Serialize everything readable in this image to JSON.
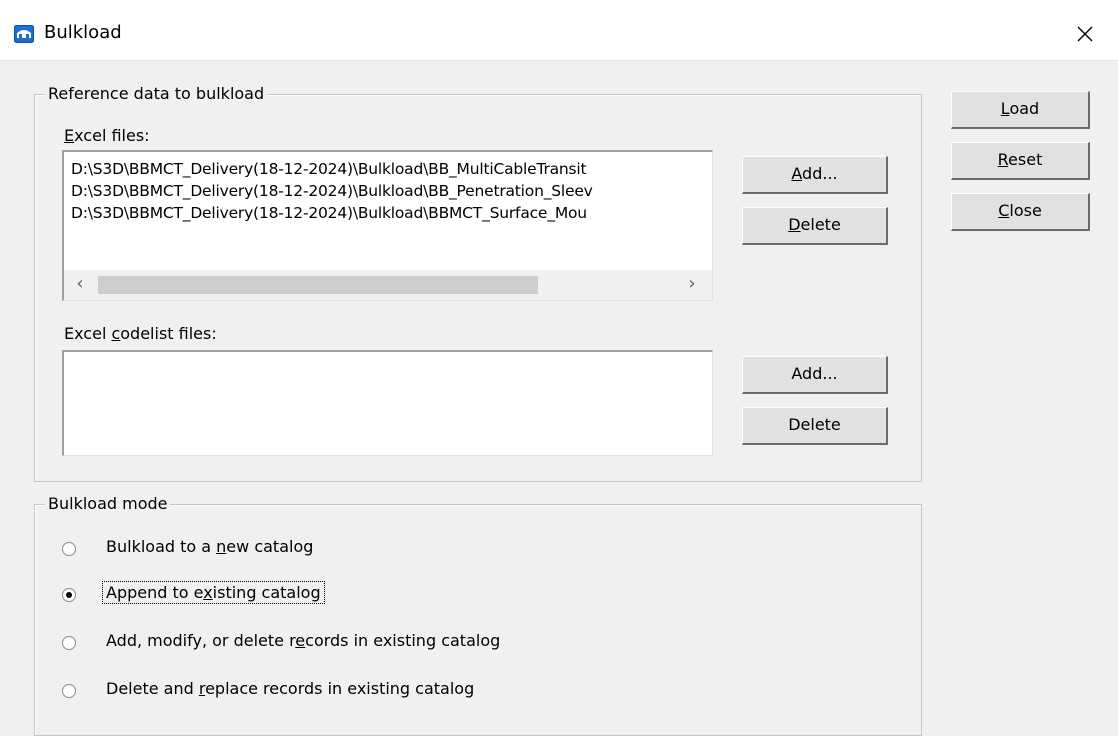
{
  "window": {
    "title": "Bulkload"
  },
  "reference_group": {
    "title": "Reference data to bulkload",
    "excel_files_label_pre": "",
    "excel_files_label_u": "E",
    "excel_files_label_post": "xcel files:",
    "excel_files": [
      "D:\\S3D\\BBMCT_Delivery(18-12-2024)\\Bulkload\\BB_MultiCableTransit",
      "D:\\S3D\\BBMCT_Delivery(18-12-2024)\\Bulkload\\BB_Penetration_Sleev",
      "D:\\S3D\\BBMCT_Delivery(18-12-2024)\\Bulkload\\BBMCT_Surface_Mou"
    ],
    "excel_add_pre": "",
    "excel_add_u": "A",
    "excel_add_post": "dd...",
    "excel_delete_pre": "",
    "excel_delete_u": "D",
    "excel_delete_post": "elete",
    "codelist_label_pre": "Excel ",
    "codelist_label_u": "c",
    "codelist_label_post": "odelist files:",
    "codelist_files": [],
    "codelist_add": "Add...",
    "codelist_delete": "Delete"
  },
  "side_buttons": {
    "load_u": "L",
    "load_post": "oad",
    "reset_u": "R",
    "reset_post": "eset",
    "close_u": "C",
    "close_post": "lose"
  },
  "mode_group": {
    "title": "Bulkload mode",
    "options": [
      {
        "pre": "Bulkload to a ",
        "u": "n",
        "post": "ew catalog",
        "selected": false
      },
      {
        "pre": "Append to e",
        "u": "x",
        "post": "isting  catalog",
        "selected": true
      },
      {
        "pre": "Add, modify, or delete r",
        "u": "e",
        "post": "cords in existing catalog",
        "selected": false
      },
      {
        "pre": "Delete and ",
        "u": "r",
        "post": "eplace records in existing catalog",
        "selected": false
      }
    ]
  },
  "icons": {
    "app": "bulkload-app-icon",
    "close": "close-icon",
    "scroll_left": "chevron-left-icon",
    "scroll_right": "chevron-right-icon",
    "radio": "radio-button"
  },
  "colors": {
    "dialog_bg": "#f0f0f0",
    "titlebar_bg": "#ffffff",
    "app_icon_blue": "#1a6fd0",
    "button_face": "#e1e1e1"
  }
}
